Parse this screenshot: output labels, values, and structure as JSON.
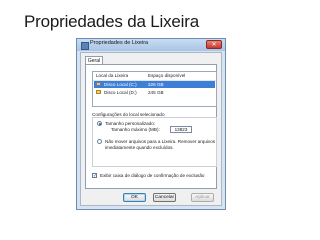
{
  "slide": {
    "title": "Propriedades da Lixeira"
  },
  "window": {
    "title": "Propriedades de Lixeira",
    "close_symbol": "✕",
    "tab": "Geral",
    "list": {
      "headers": [
        "Local da Lixeira",
        "Espaço disponível"
      ],
      "rows": [
        {
          "name": "Disco Local (C:)",
          "space": "226 GB",
          "selected": true,
          "icon": "hard-drive-icon"
        },
        {
          "name": "Disco Local (D:)",
          "space": "245 GB",
          "selected": false,
          "icon": "drive-icon"
        }
      ]
    },
    "settings": {
      "section_label": "Configurações do local selecionado",
      "custom_size_label": "Tamanho personalizado:",
      "max_size_label": "Tamanho máximo (MB):",
      "max_size_value": "13823",
      "no_move_line1": "Não mover arquivos para a Lixeira. Remover arquivos",
      "no_move_line2": "imediatamente quando excluídos.",
      "confirm_label": "Exibir caixa de diálogo de confirmação de exclusão",
      "check_symbol": "✓"
    },
    "buttons": {
      "ok": "OK",
      "cancel": "Cancelar",
      "apply": "Aplicar"
    }
  },
  "colors": {
    "selection": "#3d7fd6",
    "window_frame": "#d6e3f3"
  }
}
